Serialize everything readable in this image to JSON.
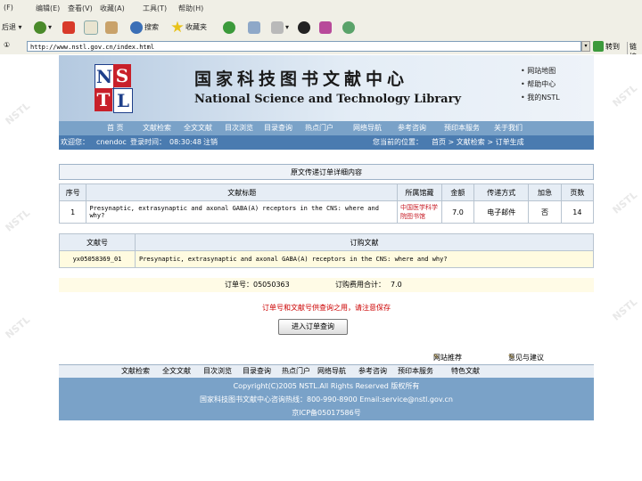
{
  "browser": {
    "menu": [
      "(F)",
      "编辑(E)",
      "查看(V)",
      "收藏(A)",
      "工具(T)",
      "帮助(H)"
    ],
    "toolbar": {
      "back": "后退",
      "search": "搜索",
      "favorites": "收藏夹"
    },
    "address_label": "①",
    "address_url": "http://www.nstl.gov.cn/index.html",
    "go_label": "转到",
    "links_label": "链接"
  },
  "header": {
    "logo_letters": [
      "N",
      "S",
      "T",
      "L"
    ],
    "title_cn": "国家科技图书文献中心",
    "title_en": "National Science and Technology Library",
    "quicklinks": [
      "• 网站地图",
      "• 帮助中心",
      "• 我的NSTL"
    ]
  },
  "nav": [
    "首 页",
    "文献检索",
    "全文文献",
    "目次浏览",
    "目录查询",
    "热点门户",
    "网络导航",
    "参考咨询",
    "预印本服务",
    "关于我们"
  ],
  "welcome": {
    "user_label": "欢迎您：",
    "user": "cnendoc",
    "login_time_label": "登录时间：",
    "login_time": "08:30:48",
    "logout": "注销",
    "location_label": "您当前的位置：",
    "location": "首页 > 文献检索 > 订单生成"
  },
  "order_box": {
    "title": "原文传递订单详细内容",
    "headers": [
      "序号",
      "文献标题",
      "所属馆藏",
      "金额",
      "传递方式",
      "加急",
      "页数"
    ],
    "rows": [
      {
        "no": "1",
        "title": "Presynaptic, extrasynaptic and axonal GABA(A) receptors in the CNS: where and why?",
        "library": "中国医学科学院图书馆",
        "amount": "7.0",
        "method": "电子邮件",
        "urgent": "否",
        "pages": "14"
      }
    ]
  },
  "detail": {
    "headers": [
      "文献号",
      "订购文献"
    ],
    "id": "yx05058369_01",
    "title": "Presynaptic, extrasynaptic and axonal GABA(A) receptors in the CNS: where and why?"
  },
  "order_summary": {
    "order_no_label": "订单号：",
    "order_no": "05050363",
    "total_label": "订购费用合计：",
    "total": "7.0"
  },
  "warning": "订单号和文献号供查询之用，请注意保存",
  "button_label": "进入订单查询",
  "feedback": {
    "recommend": "网站推荐",
    "suggest": "意见与建议"
  },
  "footer_nav": [
    "文献检索",
    "全文文献",
    "目次浏览",
    "目录查询",
    "热点门户",
    "网络导航",
    "参考咨询",
    "预印本服务",
    "特色文献"
  ],
  "footer": {
    "copyright": "Copyright(C)2005 NSTL.All Rights Reserved 版权所有",
    "contact": "国家科技图书文献中心咨询热线：800-990-8900 Email:service@nstl.gov.cn",
    "icp": "京ICP备05017586号"
  },
  "watermark": "NSTL"
}
